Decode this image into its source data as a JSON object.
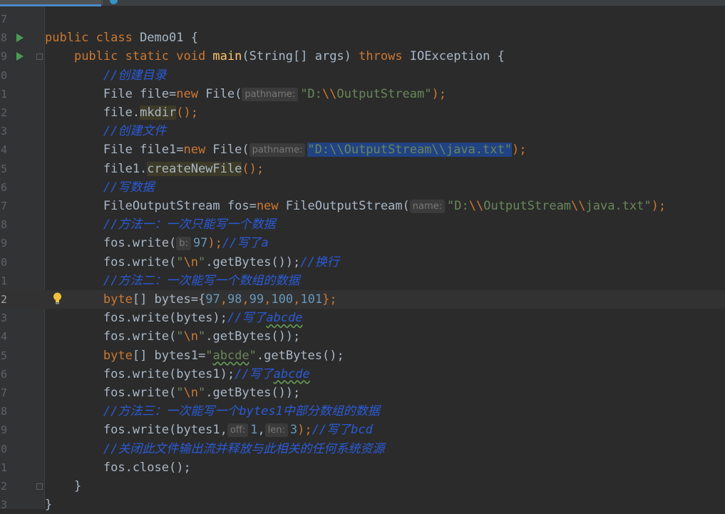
{
  "editor": {
    "lines": [
      {
        "num": "7",
        "tokens": []
      },
      {
        "num": "8",
        "run": true,
        "tokens": [
          {
            "t": "public class ",
            "c": "kw"
          },
          {
            "t": "Demo01 {"
          }
        ]
      },
      {
        "num": "9",
        "run": true,
        "fold": true,
        "tokens": [
          {
            "t": "    "
          },
          {
            "t": "public static void ",
            "c": "kw"
          },
          {
            "t": "main",
            "c": "fn"
          },
          {
            "t": "(String[] args) "
          },
          {
            "t": "throws ",
            "c": "kw"
          },
          {
            "t": "IOException {"
          }
        ]
      },
      {
        "num": "0",
        "tokens": [
          {
            "t": "        "
          },
          {
            "t": "//创建目录",
            "c": "cmz"
          }
        ]
      },
      {
        "num": "1",
        "tokens": [
          {
            "t": "        File file="
          },
          {
            "t": "new ",
            "c": "kw"
          },
          {
            "t": "File("
          },
          {
            "hint": "pathname:"
          },
          {
            "t": "\"D:",
            "c": "str"
          },
          {
            "t": "\\\\",
            "c": "esc"
          },
          {
            "t": "OutputStream\"",
            "c": "str"
          },
          {
            "t": ");",
            "c": "kw"
          }
        ]
      },
      {
        "num": "2",
        "tokens": [
          {
            "t": "        file."
          },
          {
            "t": "mkdir",
            "c": "warn"
          },
          {
            "t": "();",
            "c": "kw"
          }
        ]
      },
      {
        "num": "3",
        "tokens": [
          {
            "t": "        "
          },
          {
            "t": "//创建文件",
            "c": "cmz"
          }
        ]
      },
      {
        "num": "4",
        "tokens": [
          {
            "t": "        File file1="
          },
          {
            "t": "new ",
            "c": "kw"
          },
          {
            "t": "File("
          },
          {
            "hint": "pathname:"
          },
          {
            "t": "\"D:\\\\OutputStream\\\\java.txt\"",
            "c": "str sel"
          },
          {
            "t": ");",
            "c": "kw"
          }
        ]
      },
      {
        "num": "5",
        "tokens": [
          {
            "t": "        file1."
          },
          {
            "t": "createNewFile",
            "c": "warn"
          },
          {
            "t": "();",
            "c": "kw"
          }
        ]
      },
      {
        "num": "6",
        "tokens": [
          {
            "t": "        "
          },
          {
            "t": "//写数据",
            "c": "cmz"
          }
        ]
      },
      {
        "num": "7",
        "tokens": [
          {
            "t": "        FileOutputStream fos="
          },
          {
            "t": "new ",
            "c": "kw"
          },
          {
            "t": "FileOutputStream("
          },
          {
            "hint": "name:"
          },
          {
            "t": "\"D:",
            "c": "str"
          },
          {
            "t": "\\\\",
            "c": "esc"
          },
          {
            "t": "OutputStream",
            "c": "str"
          },
          {
            "t": "\\\\",
            "c": "esc"
          },
          {
            "t": "java.txt\"",
            "c": "str"
          },
          {
            "t": ");",
            "c": "kw"
          }
        ]
      },
      {
        "num": "8",
        "tokens": [
          {
            "t": "        "
          },
          {
            "t": "//方法一：一次只能写一个数据",
            "c": "cmz"
          }
        ]
      },
      {
        "num": "9",
        "tokens": [
          {
            "t": "        fos.write("
          },
          {
            "hint": "b:"
          },
          {
            "t": "97",
            "c": "num"
          },
          {
            "t": ");",
            "c": "kw"
          },
          {
            "t": "//写了a",
            "c": "cmz"
          }
        ]
      },
      {
        "num": "0",
        "tokens": [
          {
            "t": "        fos.write("
          },
          {
            "t": "\"",
            "c": "str"
          },
          {
            "t": "\\n",
            "c": "esc"
          },
          {
            "t": "\"",
            "c": "str"
          },
          {
            "t": ".getBytes());"
          },
          {
            "t": "//换行",
            "c": "cmz"
          }
        ]
      },
      {
        "num": "1",
        "tokens": [
          {
            "t": "        "
          },
          {
            "t": "//方法二：一次能写一个数组的数据",
            "c": "cmz"
          }
        ]
      },
      {
        "num": "2",
        "current": true,
        "bulb": true,
        "tokens": [
          {
            "t": "        "
          },
          {
            "t": "byte",
            "c": "kw"
          },
          {
            "t": "[] bytes={"
          },
          {
            "t": "97",
            "c": "num"
          },
          {
            "t": ",",
            "c": "kw"
          },
          {
            "t": "98",
            "c": "num"
          },
          {
            "t": ",",
            "c": "kw"
          },
          {
            "t": "99",
            "c": "num"
          },
          {
            "t": ",",
            "c": "kw"
          },
          {
            "t": "100",
            "c": "num"
          },
          {
            "t": ",",
            "c": "kw"
          },
          {
            "t": "101",
            "c": "num"
          },
          {
            "t": "};",
            "c": "kw"
          }
        ]
      },
      {
        "num": "3",
        "tokens": [
          {
            "t": "        fos.write(bytes);"
          },
          {
            "t": "//写了",
            "c": "cmz"
          },
          {
            "t": "abcde",
            "c": "cmz typo"
          }
        ]
      },
      {
        "num": "4",
        "tokens": [
          {
            "t": "        fos.write("
          },
          {
            "t": "\"",
            "c": "str"
          },
          {
            "t": "\\n",
            "c": "esc"
          },
          {
            "t": "\"",
            "c": "str"
          },
          {
            "t": ".getBytes());"
          }
        ]
      },
      {
        "num": "5",
        "tokens": [
          {
            "t": "        "
          },
          {
            "t": "byte",
            "c": "kw"
          },
          {
            "t": "[] bytes1="
          },
          {
            "t": "\"",
            "c": "str"
          },
          {
            "t": "abcde",
            "c": "str typo"
          },
          {
            "t": "\"",
            "c": "str"
          },
          {
            "t": ".getBytes();"
          }
        ]
      },
      {
        "num": "6",
        "tokens": [
          {
            "t": "        fos.write(bytes1);"
          },
          {
            "t": "//写了",
            "c": "cmz"
          },
          {
            "t": "abcde",
            "c": "cmz typo"
          }
        ]
      },
      {
        "num": "7",
        "tokens": [
          {
            "t": "        fos.write("
          },
          {
            "t": "\"",
            "c": "str"
          },
          {
            "t": "\\n",
            "c": "esc"
          },
          {
            "t": "\"",
            "c": "str"
          },
          {
            "t": ".getBytes());"
          }
        ]
      },
      {
        "num": "8",
        "tokens": [
          {
            "t": "        "
          },
          {
            "t": "//方法三：一次能写一个bytes1中部分数组的数据",
            "c": "cmz"
          }
        ]
      },
      {
        "num": "9",
        "tokens": [
          {
            "t": "        fos.write(bytes1,"
          },
          {
            "hint": "off:"
          },
          {
            "t": "1",
            "c": "num"
          },
          {
            "t": ","
          },
          {
            "hint": "len:"
          },
          {
            "t": "3",
            "c": "num"
          },
          {
            "t": ");",
            "c": "kw"
          },
          {
            "t": "//写了bcd",
            "c": "cmz"
          }
        ]
      },
      {
        "num": "0",
        "tokens": [
          {
            "t": "        "
          },
          {
            "t": "//关闭此文件输出流并释放与此相关的任何系统资源",
            "c": "cmz"
          }
        ]
      },
      {
        "num": "1",
        "tokens": [
          {
            "t": "        fos.close();"
          }
        ]
      },
      {
        "num": "2",
        "fold": true,
        "tokens": [
          {
            "t": "    }"
          }
        ]
      },
      {
        "num": "3",
        "tokens": [
          {
            "t": "}"
          }
        ]
      }
    ]
  }
}
